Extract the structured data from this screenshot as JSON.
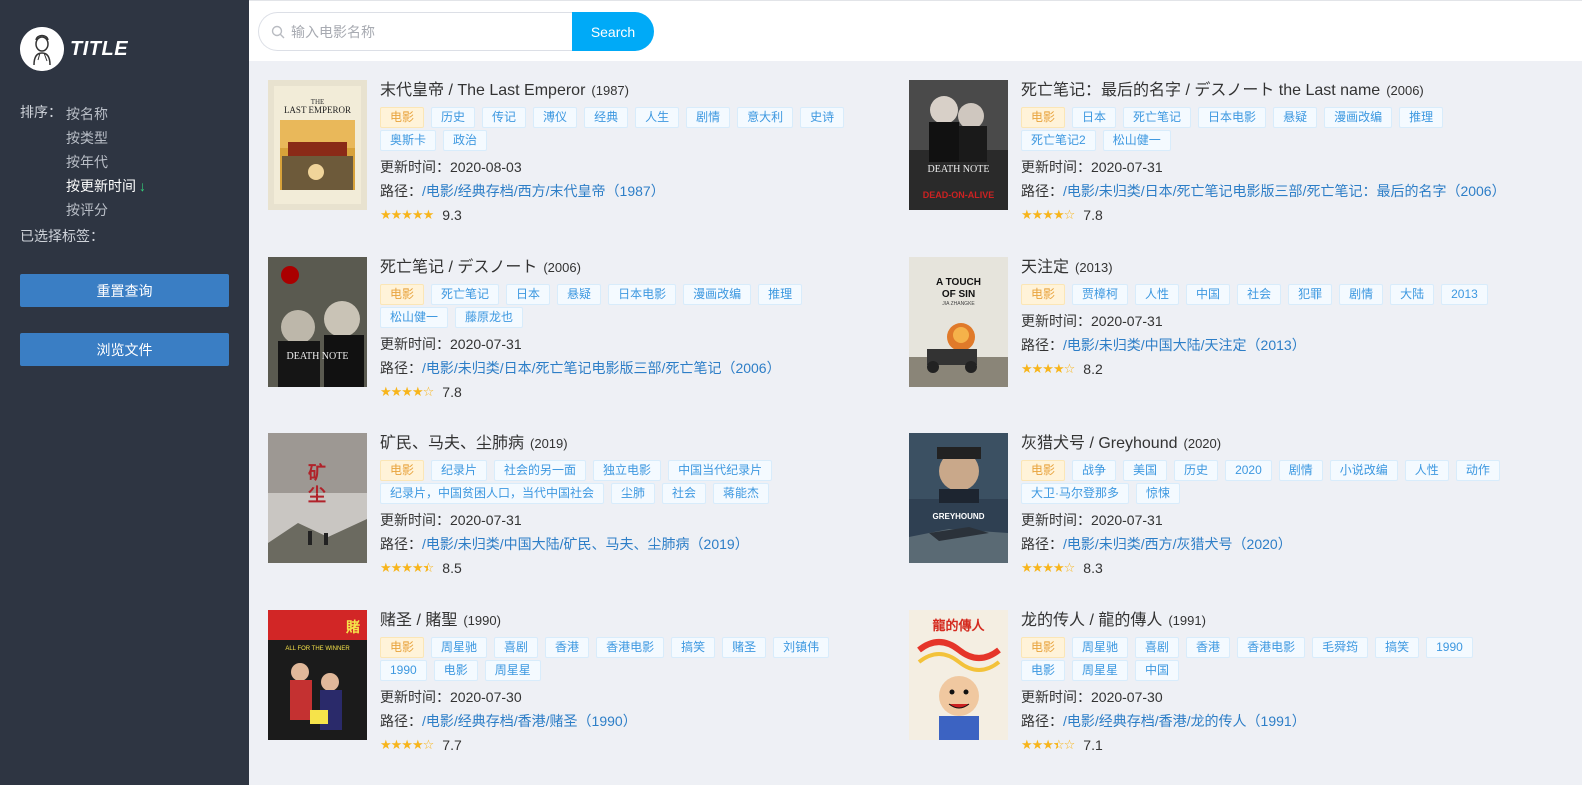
{
  "app": {
    "title": "TITLE"
  },
  "sidebar": {
    "sort_label": "排序：",
    "sort_options": [
      "按名称",
      "按类型",
      "按年代",
      "按更新时间",
      "按评分"
    ],
    "active_sort": "按更新时间",
    "active_arrow": "↓",
    "selected_tags_label": "已选择标签：",
    "reset_button": "重置查询",
    "browse_button": "浏览文件"
  },
  "search": {
    "placeholder": "输入电影名称",
    "value": "",
    "button": "Search"
  },
  "labels": {
    "update_time": "更新时间：",
    "path": "路径："
  },
  "colors": {
    "sidebar_bg": "#2e3542",
    "accent": "#00aaf7",
    "button": "#3a7ec4",
    "star": "#f7b51c",
    "link": "#2d7ec7"
  },
  "movies": [
    {
      "title": "末代皇帝 / The Last Emperor",
      "year": "(1987)",
      "tags": [
        "电影",
        "历史",
        "传记",
        "溥仪",
        "经典",
        "人生",
        "剧情",
        "意大利",
        "史诗",
        "奥斯卡",
        "政治"
      ],
      "updated": "2020-08-03",
      "path": "/电影/经典存档/西方/末代皇帝（1987）",
      "stars": 5,
      "score": "9.3",
      "poster": "last-emperor"
    },
    {
      "title": "死亡笔记：最后的名字 / デスノート the Last name",
      "year": "(2006)",
      "tags": [
        "电影",
        "日本",
        "死亡笔记",
        "日本电影",
        "悬疑",
        "漫画改编",
        "推理",
        "死亡笔记2",
        "松山健一"
      ],
      "updated": "2020-07-31",
      "path": "/电影/未归类/日本/死亡笔记电影版三部/死亡笔记：最后的名字（2006）",
      "stars": 4,
      "score": "7.8",
      "poster": "death-note-2"
    },
    {
      "title": "死亡笔记 / デスノート",
      "year": "(2006)",
      "tags": [
        "电影",
        "死亡笔记",
        "日本",
        "悬疑",
        "日本电影",
        "漫画改编",
        "推理",
        "松山健一",
        "藤原龙也"
      ],
      "updated": "2020-07-31",
      "path": "/电影/未归类/日本/死亡笔记电影版三部/死亡笔记（2006）",
      "stars": 4,
      "score": "7.8",
      "poster": "death-note"
    },
    {
      "title": "天注定",
      "year": "(2013)",
      "tags": [
        "电影",
        "贾樟柯",
        "人性",
        "中国",
        "社会",
        "犯罪",
        "剧情",
        "大陆",
        "2013"
      ],
      "updated": "2020-07-31",
      "path": "/电影/未归类/中国大陆/天注定（2013）",
      "stars": 4,
      "score": "8.2",
      "poster": "touch-of-sin"
    },
    {
      "title": "矿民、马夫、尘肺病",
      "year": "(2019)",
      "tags": [
        "电影",
        "纪录片",
        "社会的另一面",
        "独立电影",
        "中国当代纪录片",
        "纪录片，中国贫困人口，当代中国社会",
        "尘肺",
        "社会",
        "蒋能杰"
      ],
      "updated": "2020-07-31",
      "path": "/电影/未归类/中国大陆/矿民、马夫、尘肺病（2019）",
      "stars": 4.5,
      "score": "8.5",
      "poster": "miners"
    },
    {
      "title": "灰猎犬号 / Greyhound",
      "year": "(2020)",
      "tags": [
        "电影",
        "战争",
        "美国",
        "历史",
        "2020",
        "剧情",
        "小说改编",
        "人性",
        "动作",
        "大卫·马尔登那多",
        "惊悚"
      ],
      "updated": "2020-07-31",
      "path": "/电影/未归类/西方/灰猎犬号（2020）",
      "stars": 4,
      "score": "8.3",
      "poster": "greyhound"
    },
    {
      "title": "赌圣 / 賭聖",
      "year": "(1990)",
      "tags": [
        "电影",
        "周星驰",
        "喜剧",
        "香港",
        "香港电影",
        "搞笑",
        "赌圣",
        "刘镇伟",
        "1990",
        "电影",
        "周星星"
      ],
      "updated": "2020-07-30",
      "path": "/电影/经典存档/香港/赌圣（1990）",
      "stars": 4,
      "score": "7.7",
      "poster": "all-for-winner"
    },
    {
      "title": "龙的传人 / 龍的傳人",
      "year": "(1991)",
      "tags": [
        "电影",
        "周星驰",
        "喜剧",
        "香港",
        "香港电影",
        "毛舜筠",
        "搞笑",
        "1990",
        "电影",
        "周星星",
        "中国"
      ],
      "updated": "2020-07-30",
      "path": "/电影/经典存档/香港/龙的传人（1991）",
      "stars": 3.5,
      "score": "7.1",
      "poster": "dragon"
    }
  ]
}
